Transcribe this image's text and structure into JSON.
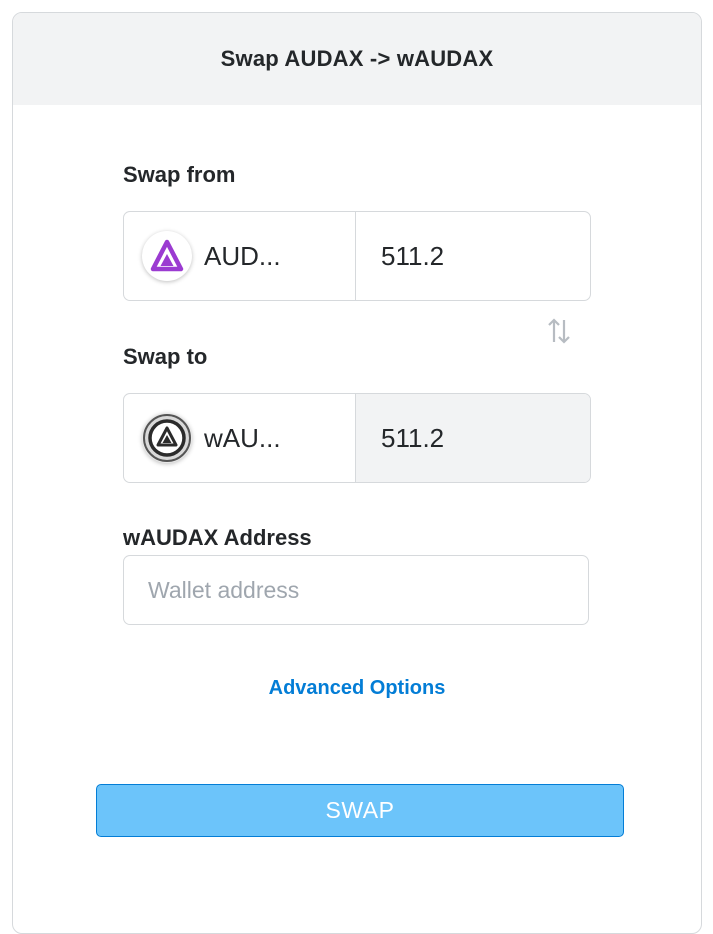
{
  "header": {
    "title": "Swap AUDAX -> wAUDAX"
  },
  "swap_from": {
    "label": "Swap from",
    "token_symbol": "AUD...",
    "token_icon": "audax-logo-icon",
    "amount": "511.2"
  },
  "swap_to": {
    "label": "Swap to",
    "token_symbol": "wAU...",
    "token_icon": "waudax-logo-icon",
    "amount": "511.2"
  },
  "address": {
    "label": "wAUDAX Address",
    "placeholder": "Wallet address",
    "value": ""
  },
  "advanced_options": {
    "label": "Advanced Options"
  },
  "actions": {
    "swap_label": "SWAP"
  },
  "colors": {
    "accent": "#037dd6",
    "button_fill": "#6cc4fa",
    "audax_purple": "#9b3bd1"
  },
  "icons": {
    "swap_direction": "swap-arrows-icon"
  }
}
